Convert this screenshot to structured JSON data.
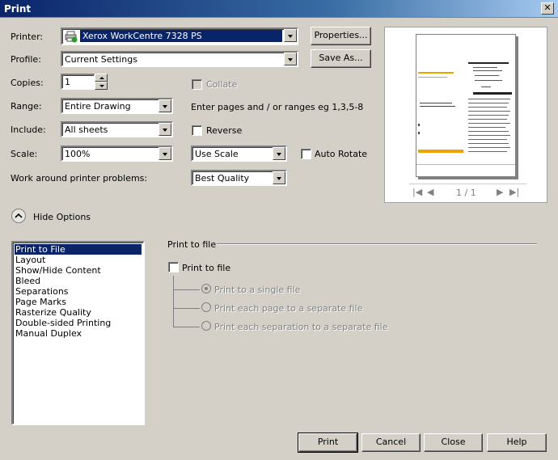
{
  "window": {
    "title": "Print",
    "close_glyph": "✕"
  },
  "printer": {
    "label": "Printer:",
    "value": "Xerox WorkCentre 7328 PS",
    "properties_button": "Properties..."
  },
  "profile": {
    "label": "Profile:",
    "value": "Current Settings",
    "save_as_button": "Save As..."
  },
  "copies": {
    "label": "Copies:",
    "value": "1",
    "collate_label": "Collate"
  },
  "range": {
    "label": "Range:",
    "value": "Entire Drawing",
    "hint": "Enter pages and / or ranges eg 1,3,5-8"
  },
  "include": {
    "label": "Include:",
    "value": "All sheets",
    "reverse_label": "Reverse"
  },
  "scale": {
    "label": "Scale:",
    "value": "100%",
    "mode": "Use Scale",
    "auto_rotate_label": "Auto Rotate"
  },
  "workaround": {
    "label": "Work around printer problems:",
    "value": "Best Quality"
  },
  "preview": {
    "page_indicator": "1 / 1"
  },
  "options_toggle": {
    "label": "Hide Options"
  },
  "option_list": {
    "items": [
      "Print to File",
      "Layout",
      "Show/Hide Content",
      "Bleed",
      "Separations",
      "Page Marks",
      "Rasterize Quality",
      "Double-sided Printing",
      "Manual Duplex"
    ],
    "selected": "Print to File"
  },
  "print_to_file": {
    "section_title": "Print to file",
    "checkbox_label": "Print to file",
    "radios": [
      "Print to a single file",
      "Print each page to a separate file",
      "Print each separation to a separate file"
    ]
  },
  "buttons": {
    "print": "Print",
    "cancel": "Cancel",
    "close": "Close",
    "help": "Help"
  },
  "colors": {
    "accent": "#0a246a",
    "dialog_bg": "#d4d0c8",
    "preview_orange": "#f0a000"
  }
}
